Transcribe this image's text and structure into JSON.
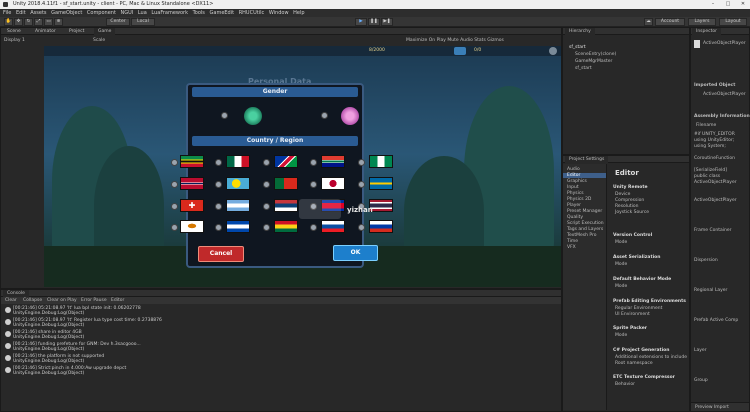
{
  "window": {
    "title": "Unity 2018.4.11f1 - sf_start.unity - client - PC, Mac & Linux Standalone <DX11>"
  },
  "menu": [
    "File",
    "Edit",
    "Assets",
    "GameObject",
    "Component",
    "NGUI",
    "Lua",
    "LuaFramework",
    "Tools",
    "GameEdit",
    "RHUCUtilc",
    "Window",
    "Help"
  ],
  "toolbar": {
    "center_label": "Center",
    "local_label": "Local",
    "account_label": "Account",
    "layers_label": "Layers",
    "layout_label": "Layout"
  },
  "scene": {
    "tabs": [
      "Scene",
      "Animator",
      "Project",
      "Game"
    ],
    "display": "Display 1",
    "scale": "Scale",
    "overlay_right": "Maximize On Play  Mute Audio  Stats  Gizmos",
    "hud_left": "8/2000",
    "hud_right": "0/0"
  },
  "dialog": {
    "title_faded": "Personal Data",
    "gender_header": "Gender",
    "region_header": "Country / Region",
    "cancel_label": "Cancel",
    "ok_label": "OK",
    "watermark": "yizhan"
  },
  "console": {
    "tab": "Console",
    "toolbar": [
      "Clear",
      "Collapse",
      "Clear on Play",
      "Error Pause",
      "Editor"
    ],
    "logs": [
      {
        "line1": "[00:21:46] 05:21:08.97 'It' lua bpl state init: 0.06202778",
        "line2": "UnityEngine.Debug:Log(Object)"
      },
      {
        "line1": "[00:21:46] 05:21:08.97 'It' Register lua type cost time: 0.2738876",
        "line2": "UnityEngine.Debug:Log(Object)"
      },
      {
        "line1": "[00:21:46] share in editor 4GB",
        "line2": "UnityEngine.Debug:Log(Object)"
      },
      {
        "line1": "[00:21:46] funding prefeture for GNM: Dev h.3sacgooo...",
        "line2": "UnityEngine.Debug:Log(Object)"
      },
      {
        "line1": "[00:21:46] the platform is not supported",
        "line2": "UnityEngine.Debug:Log(Object)"
      },
      {
        "line1": "[00:21:46] Strict:pinch in 4.000:Aw upgrade depct",
        "line2": "UnityEngine.Debug:Log(Object)"
      }
    ]
  },
  "hierarchy": {
    "tab": "Hierarchy",
    "items": [
      "sf_start",
      "SceneEntry(clone)",
      "GameMgrMaster",
      "sf_start"
    ]
  },
  "project_settings": {
    "tab": "Project Settings",
    "categories": [
      "Audio",
      "Editor",
      "Graphics",
      "Input",
      "Physics",
      "Physics 2D",
      "Player",
      "Preset Manager",
      "Quality",
      "Script Execution",
      "Tags and Layers",
      "TextMesh Pro",
      "Time",
      "VFX"
    ],
    "section_title": "Editor",
    "groups": [
      {
        "title": "Unity Remote",
        "rows": [
          "Device",
          "Compression",
          "Resolution",
          "Joystick Source"
        ]
      },
      {
        "title": "Version Control",
        "rows": [
          "Mode"
        ]
      },
      {
        "title": "Asset Serialization",
        "rows": [
          "Mode"
        ]
      },
      {
        "title": "Default Behavior Mode",
        "rows": [
          "Mode"
        ]
      },
      {
        "title": "Prefab Editing Environments",
        "rows": [
          "Regular Environment",
          "UI Environment"
        ]
      },
      {
        "title": "Sprite Packer",
        "rows": [
          "Mode"
        ]
      },
      {
        "title": "C# Project Generation",
        "rows": [
          "Additional extensions to include",
          "Root namespace"
        ]
      },
      {
        "title": "ETC Texture Compressor",
        "rows": [
          "Behavior"
        ]
      }
    ]
  },
  "inspector": {
    "tab": "Inspector",
    "lines": [
      "ActiveObjectPlayer",
      "Imported Object",
      "ActiveObjectPlayer",
      "Assembly Information",
      "Filename",
      "#if UNITY_EDITOR",
      "using UnityEditor;",
      "using System;",
      "CoroutineFunction",
      "[SerializeField]",
      "public class",
      "ActiveObjectPlayer",
      "ActiveObjectPlayer",
      "Frame Container",
      "Dispersion",
      "Regional Layer",
      "Prefab Active Comp",
      "Layer",
      "Group"
    ],
    "footer": "Preview Import"
  },
  "colors": {
    "accent": "#2a5b93",
    "cancel": "#c0292a",
    "ok": "#1d7fcc"
  }
}
